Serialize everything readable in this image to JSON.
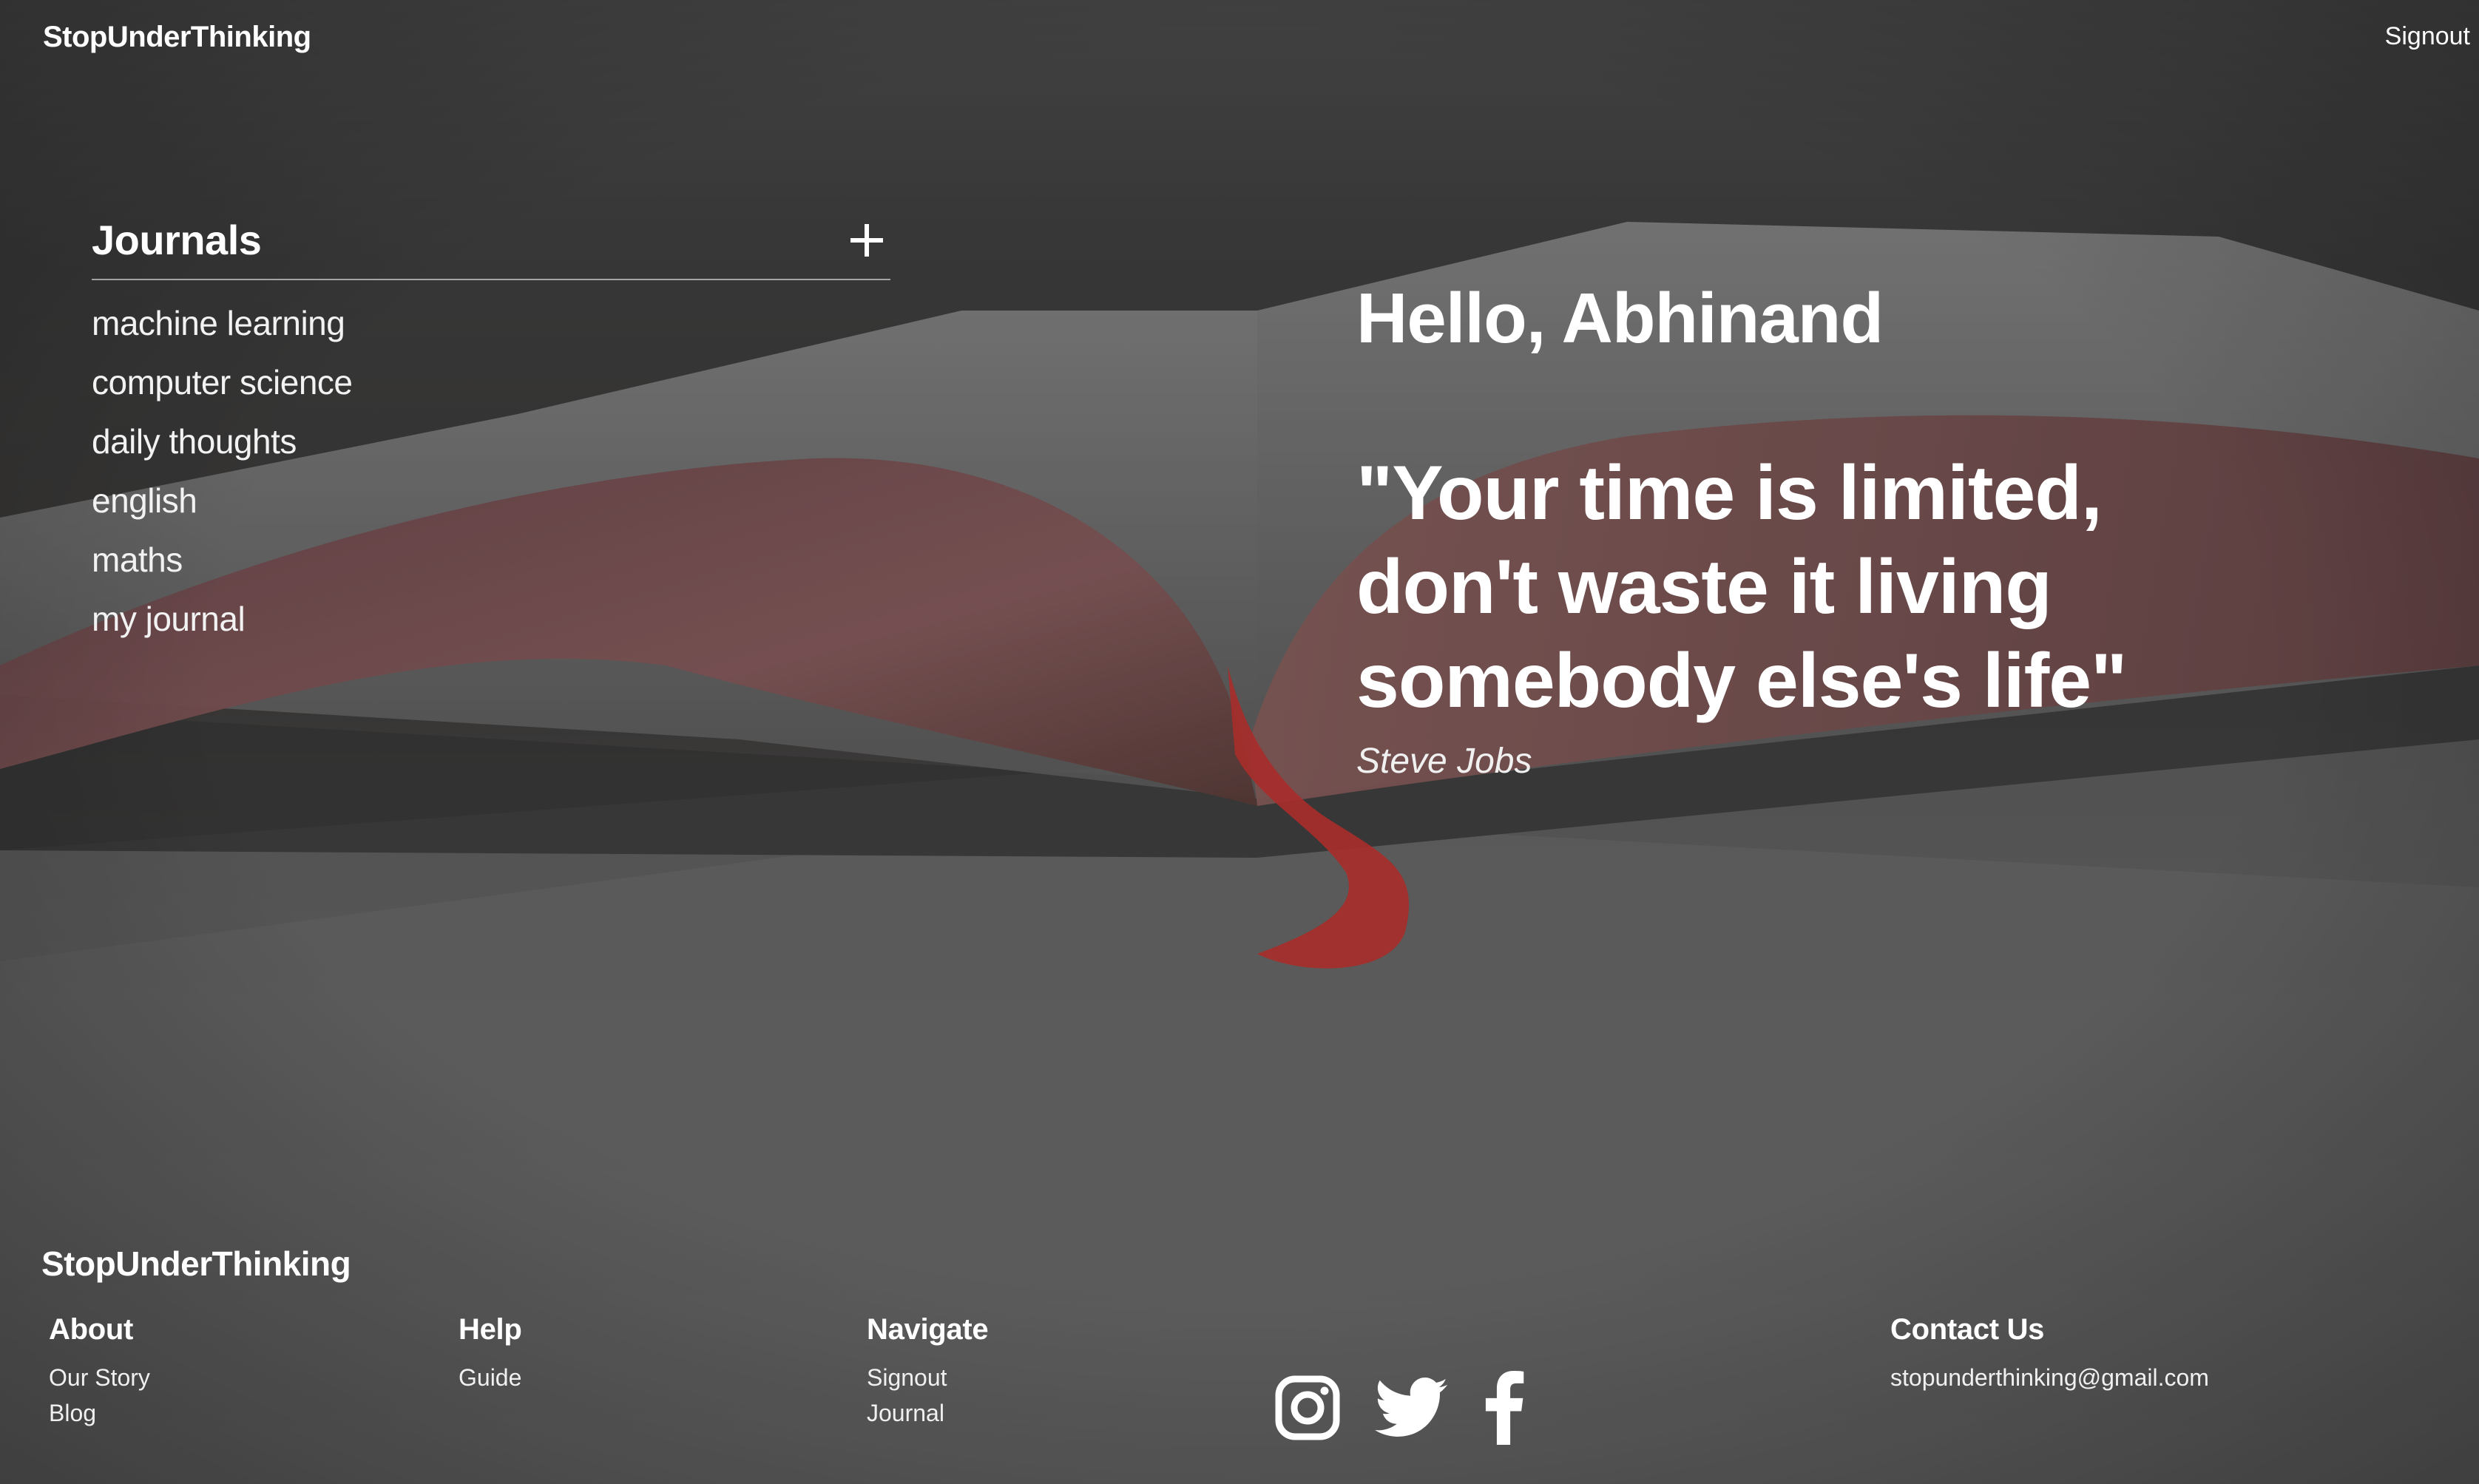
{
  "header": {
    "brand": "StopUnderThinking",
    "signout_label": "Signout"
  },
  "journals": {
    "title": "Journals",
    "add_icon": "plus-icon",
    "items": [
      {
        "label": "machine learning"
      },
      {
        "label": "computer science"
      },
      {
        "label": "daily thoughts"
      },
      {
        "label": "english"
      },
      {
        "label": "maths"
      },
      {
        "label": "my journal"
      }
    ]
  },
  "main": {
    "greeting": "Hello, Abhinand",
    "quote": "\"Your time is limited, don't waste it living somebody else's life\"",
    "quote_author": "Steve Jobs"
  },
  "footer": {
    "brand": "StopUnderThinking",
    "about": {
      "title": "About",
      "links": [
        "Our Story",
        "Blog"
      ]
    },
    "help": {
      "title": "Help",
      "links": [
        "Guide"
      ]
    },
    "navigate": {
      "title": "Navigate",
      "links": [
        "Signout",
        "Journal"
      ]
    },
    "contact": {
      "title": "Contact Us",
      "email": "stopunderthinking@gmail.com"
    },
    "social": [
      {
        "name": "instagram-icon"
      },
      {
        "name": "twitter-icon"
      },
      {
        "name": "facebook-icon"
      }
    ]
  },
  "colors": {
    "text": "#ffffff",
    "background_dark": "#3c3c3c",
    "bookmark_red": "#c8312e",
    "page_edge": "#7a4a4e"
  }
}
